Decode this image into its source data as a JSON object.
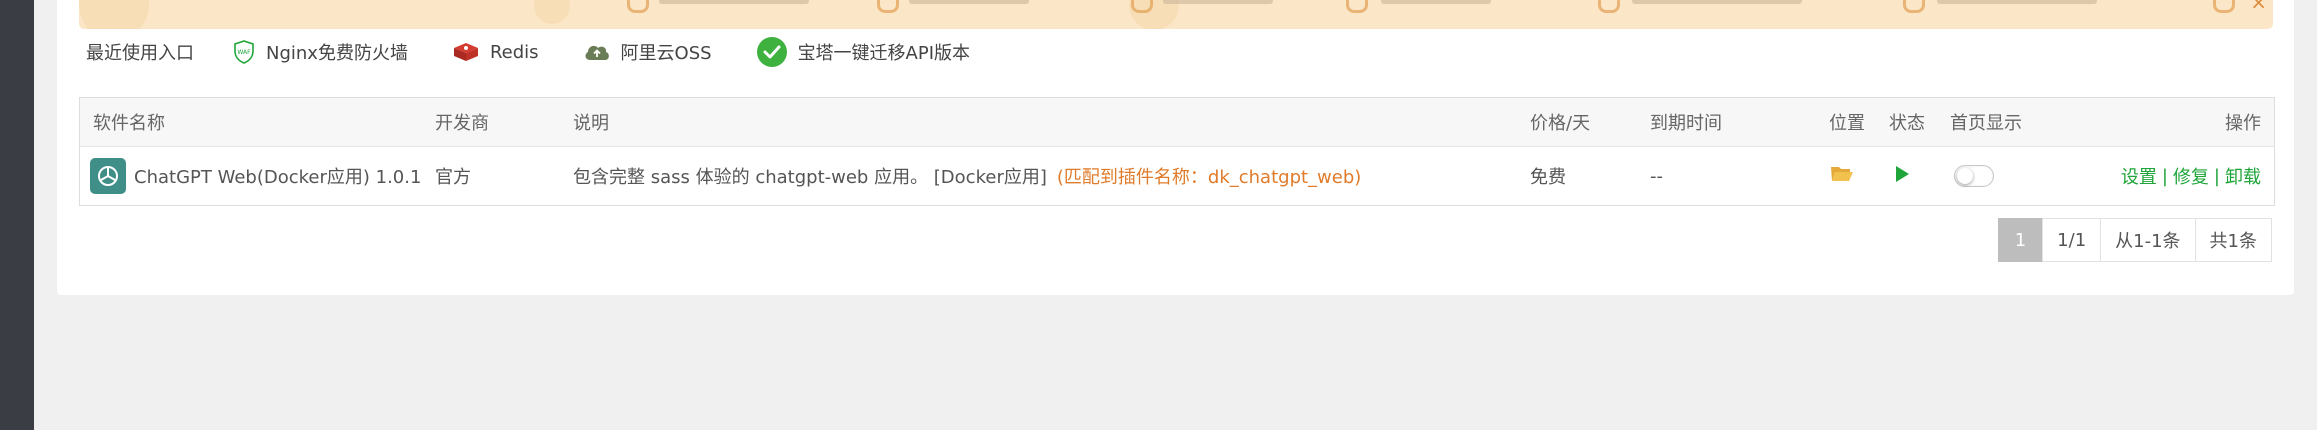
{
  "recent": {
    "label": "最近使用入口",
    "items": [
      {
        "label": "Nginx免费防火墙",
        "icon": "waf-shield-icon"
      },
      {
        "label": "Redis",
        "icon": "redis-icon"
      },
      {
        "label": "阿里云OSS",
        "icon": "cloud-upload-icon"
      },
      {
        "label": "宝塔一键迁移API版本",
        "icon": "check-circle-icon"
      }
    ]
  },
  "table": {
    "headers": {
      "name": "软件名称",
      "developer": "开发商",
      "description": "说明",
      "price": "价格/天",
      "expire": "到期时间",
      "location": "位置",
      "status": "状态",
      "homepage": "首页显示",
      "ops": "操作"
    },
    "rows": [
      {
        "name": "ChatGPT Web(Docker应用) 1.0.1",
        "developer": "官方",
        "description": "包含完整 sass 体验的 chatgpt-web 应用。 [Docker应用]",
        "match": "(匹配到插件名称：dk_chatgpt_web)",
        "price": "免费",
        "expire": "--",
        "homepage_enabled": false,
        "ops": {
          "settings": "设置",
          "repair": "修复",
          "uninstall": "卸载",
          "separator": "|"
        }
      }
    ]
  },
  "pager": {
    "current": "1",
    "pages": "1/1",
    "range": "从1-1条",
    "total": "共1条"
  },
  "colors": {
    "accent_green": "#20a53a",
    "match_orange": "#e07b2a",
    "banner_bg": "#fbe7c8",
    "nav_dark": "#3b3d44"
  }
}
